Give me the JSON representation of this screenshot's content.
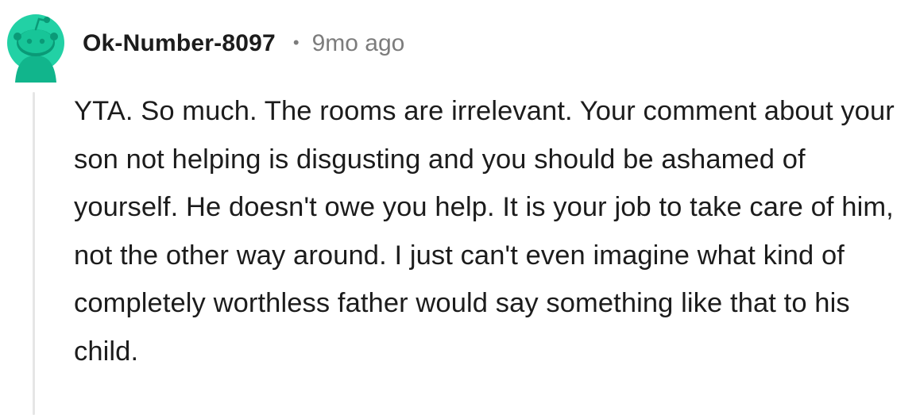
{
  "comment": {
    "avatar_icon": "reddit-snoo-avatar-icon",
    "accent_color": "#22d1a5",
    "username": "Ok-Number-8097",
    "separator": "•",
    "timestamp": "9mo ago",
    "body": "YTA. So much. The rooms are irrelevant. Your comment about your son not helping is disgusting and you should be ashamed of yourself. He doesn't owe you help. It is your job to take care of him, not the other way around. I just can't even imagine what kind of completely worthless father would say something like that to his child."
  }
}
